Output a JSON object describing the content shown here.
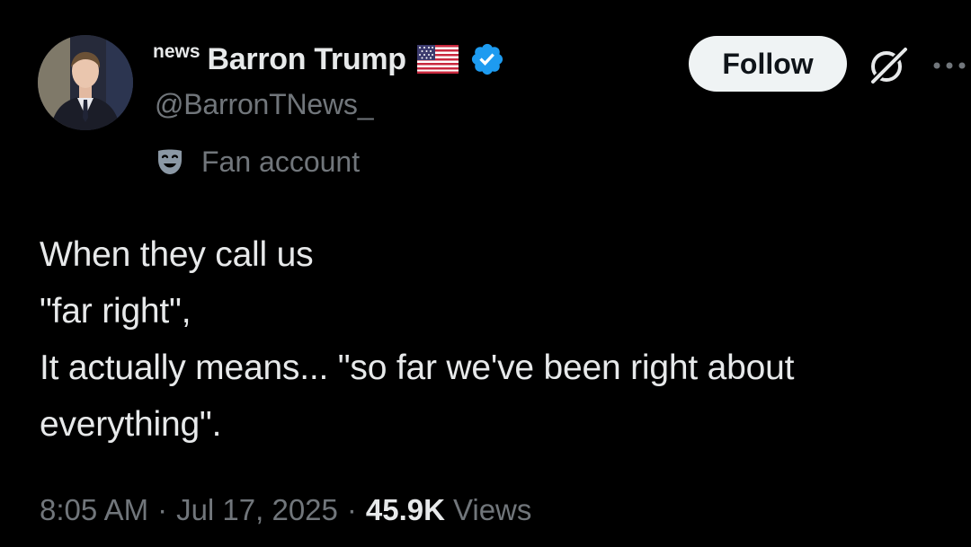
{
  "author": {
    "name_prefix": "news",
    "display_name": "Barron Trump",
    "handle": "@BarronTNews_",
    "flag": "us-flag-icon",
    "verified": true,
    "verified_color": "#1d9bf0",
    "label_icon": "theater-mask-icon",
    "label": "Fan account"
  },
  "actions": {
    "follow_label": "Follow",
    "grok_icon": "grok-icon",
    "more_icon": "more-icon"
  },
  "tweet": {
    "lines": [
      "When they call us",
      "\"far right\",",
      "It actually means... \"so far we've been right about",
      "everything\"."
    ]
  },
  "meta": {
    "time": "8:05 AM",
    "separator": "·",
    "date": "Jul 17, 2025",
    "views_count": "45.9K",
    "views_label": "Views"
  },
  "colors": {
    "background": "#000000",
    "text_primary": "#e7e9ea",
    "text_secondary": "#71767b",
    "follow_bg": "#eff3f4"
  }
}
